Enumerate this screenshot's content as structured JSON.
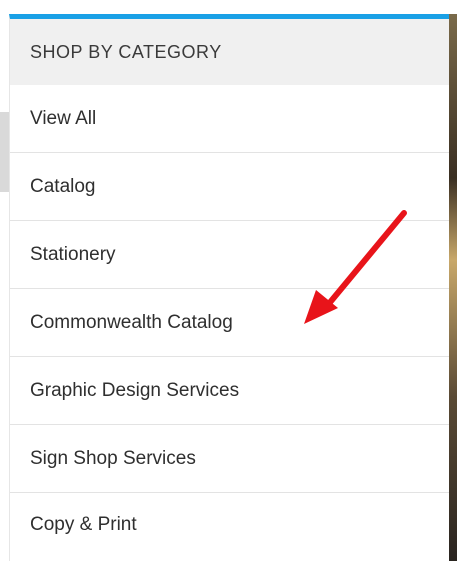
{
  "menu": {
    "header": "SHOP BY CATEGORY",
    "items": [
      {
        "label": "View All"
      },
      {
        "label": "Catalog"
      },
      {
        "label": "Stationery"
      },
      {
        "label": "Commonwealth Catalog"
      },
      {
        "label": "Graphic Design Services"
      },
      {
        "label": "Sign Shop Services"
      },
      {
        "label": "Copy & Print"
      }
    ]
  },
  "colors": {
    "accent": "#19a0e6",
    "annotation_arrow": "#e8141a",
    "header_bg": "#f0f0f0"
  },
  "annotation": {
    "icon": "red-arrow-icon",
    "points_to": "Commonwealth Catalog"
  }
}
